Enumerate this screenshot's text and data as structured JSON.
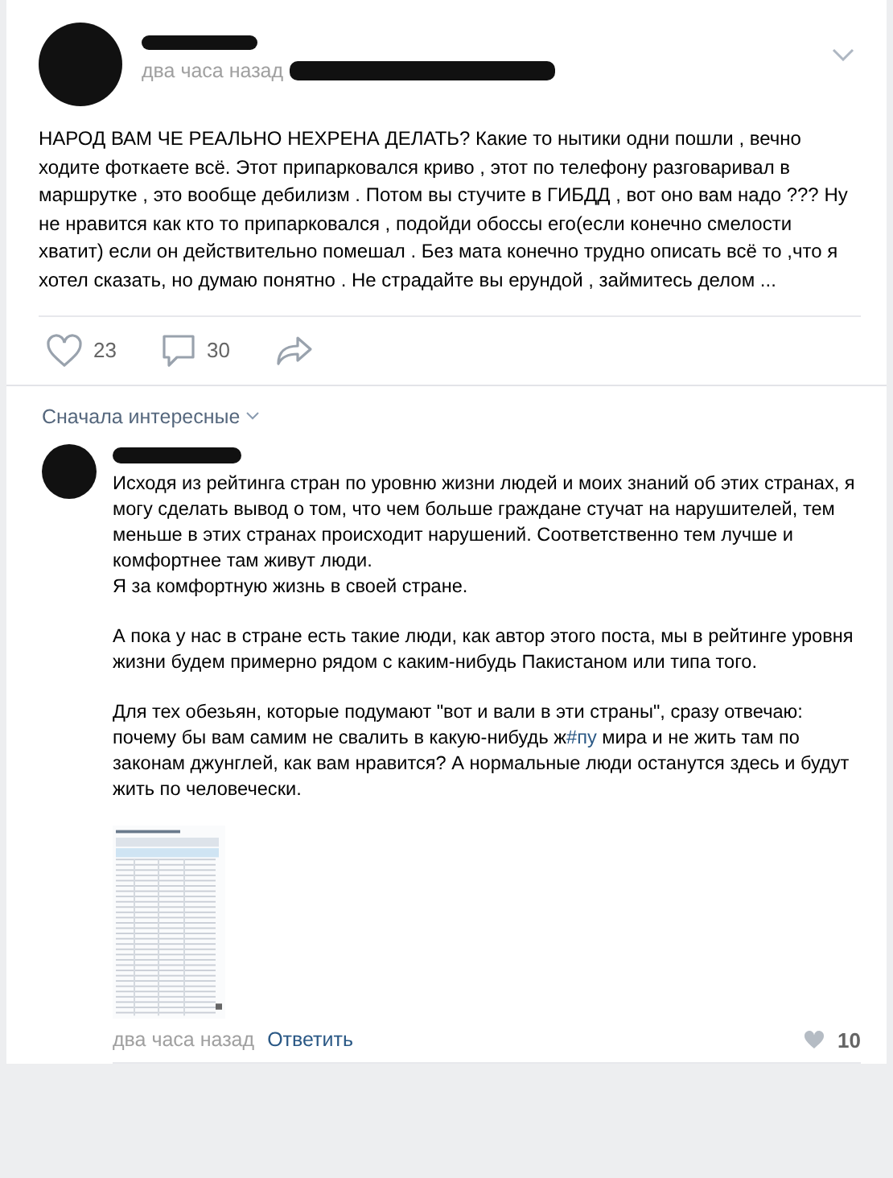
{
  "post": {
    "time": "два часа назад",
    "text": "НАРОД ВАМ ЧЕ РЕАЛЬНО НЕХРЕНА ДЕЛАТЬ? Какие то нытики одни пошли , вечно ходите фоткаете всё. Этот припарковался криво , этот по телефону разговаривал в маршрутке , это вообще дебилизм . Потом вы стучите в ГИБДД , вот оно вам надо ??? Ну не нравится как кто то припарковался , подойди обоссы его(если конечно смелости хватит) если он действительно помешал . Без мата конечно трудно описать всё то ,что я хотел сказать, но думаю понятно . Не страдайте вы ерундой , займитесь делом ...",
    "likes": "23",
    "comments": "30"
  },
  "comments_sort": "Сначала интересные",
  "comment": {
    "paragraphs": [
      {
        "text": "Исходя из рейтинга стран по уровню жизни людей и моих знаний об этих странах, я могу сделать вывод о том, что чем больше граждане стучат на нарушителей, тем меньше в этих странах происходит нарушений. Соответственно тем лучше и комфортнее там живут люди.\nЯ за комфортную жизнь в своей стране."
      },
      {
        "text": "А пока у нас в стране есть такие люди, как автор этого поста, мы в рейтинге уровня жизни будем примерно рядом с каким-нибудь Пакистаном или типа того."
      },
      {
        "text": "Для тех обезьян, которые подумают \"вот и вали в эти страны\", сразу отвечаю: почему бы вам самим не свалить в какую-нибудь ж",
        "hashtag": "#пу",
        "after": " мира и не жить там по законам джунглей, как вам нравится? А нормальные люди останутся здесь и будут жить по человечески."
      }
    ],
    "time": "два часа назад",
    "reply": "Ответить",
    "likes": "10"
  }
}
